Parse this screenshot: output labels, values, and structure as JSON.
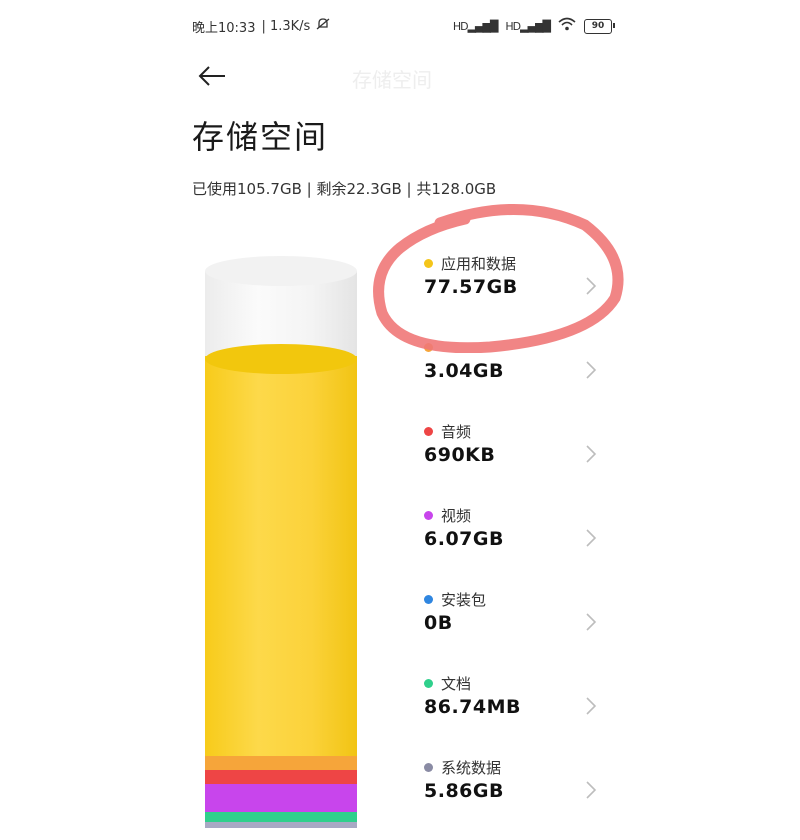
{
  "status_bar": {
    "time": "晚上10:33",
    "speed": "| 1.3K/s",
    "signal1": "HD",
    "signal2": "HD",
    "battery": "90"
  },
  "header": {
    "title_ghost": "存储空间",
    "page_title": "存储空间"
  },
  "summary": "已使用105.7GB | 剩余22.3GB | 共128.0GB",
  "categories": [
    {
      "label": "应用和数据",
      "value": "77.57GB",
      "color": "#f4c51a"
    },
    {
      "label": "",
      "value": "3.04GB",
      "color": "#f6a53a"
    },
    {
      "label": "音频",
      "value": "690KB",
      "color": "#ee4545"
    },
    {
      "label": "视频",
      "value": "6.07GB",
      "color": "#c845ec"
    },
    {
      "label": "安装包",
      "value": "0B",
      "color": "#2f86e0"
    },
    {
      "label": "文档",
      "value": "86.74MB",
      "color": "#2fd08c"
    },
    {
      "label": "系统数据",
      "value": "5.86GB",
      "color": "#8a8ba4"
    }
  ],
  "annotation_color": "#f07878"
}
